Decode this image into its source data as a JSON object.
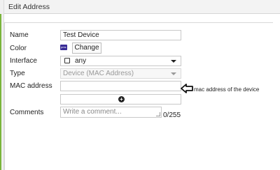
{
  "dialog": {
    "title": "Edit Address"
  },
  "form": {
    "name": {
      "label": "Name",
      "value": "Test Device"
    },
    "color": {
      "label": "Color",
      "swatch_color": "#3a2d97",
      "swatch_text": "pms",
      "change_label": "Change"
    },
    "interface": {
      "label": "Interface",
      "value": "any"
    },
    "type": {
      "label": "Type",
      "value": "Device (MAC Address)"
    },
    "mac": {
      "label": "MAC address",
      "value": "",
      "annotation": "mac address of the device"
    },
    "comments": {
      "label": "Comments",
      "placeholder": "Write a comment...",
      "counter": "0/255"
    }
  }
}
